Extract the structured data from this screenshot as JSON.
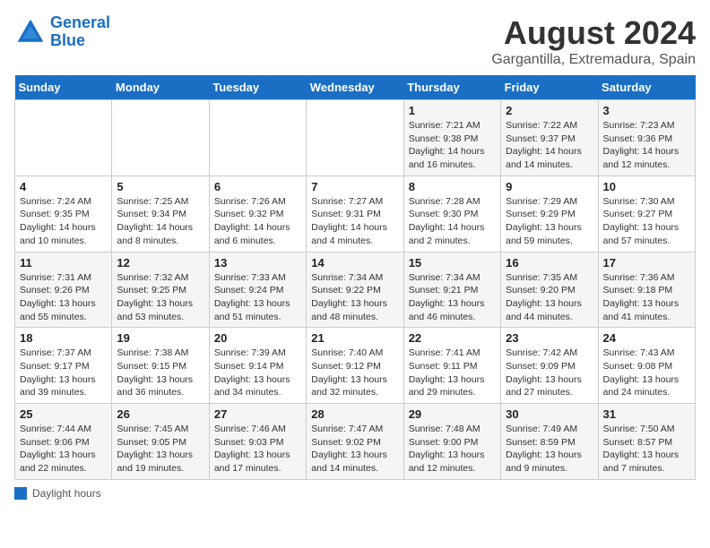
{
  "header": {
    "logo_line1": "General",
    "logo_line2": "Blue",
    "main_title": "August 2024",
    "subtitle": "Gargantilla, Extremadura, Spain"
  },
  "weekdays": [
    "Sunday",
    "Monday",
    "Tuesday",
    "Wednesday",
    "Thursday",
    "Friday",
    "Saturday"
  ],
  "weeks": [
    [
      {
        "day": "",
        "info": ""
      },
      {
        "day": "",
        "info": ""
      },
      {
        "day": "",
        "info": ""
      },
      {
        "day": "",
        "info": ""
      },
      {
        "day": "1",
        "info": "Sunrise: 7:21 AM\nSunset: 9:38 PM\nDaylight: 14 hours and 16 minutes."
      },
      {
        "day": "2",
        "info": "Sunrise: 7:22 AM\nSunset: 9:37 PM\nDaylight: 14 hours and 14 minutes."
      },
      {
        "day": "3",
        "info": "Sunrise: 7:23 AM\nSunset: 9:36 PM\nDaylight: 14 hours and 12 minutes."
      }
    ],
    [
      {
        "day": "4",
        "info": "Sunrise: 7:24 AM\nSunset: 9:35 PM\nDaylight: 14 hours and 10 minutes."
      },
      {
        "day": "5",
        "info": "Sunrise: 7:25 AM\nSunset: 9:34 PM\nDaylight: 14 hours and 8 minutes."
      },
      {
        "day": "6",
        "info": "Sunrise: 7:26 AM\nSunset: 9:32 PM\nDaylight: 14 hours and 6 minutes."
      },
      {
        "day": "7",
        "info": "Sunrise: 7:27 AM\nSunset: 9:31 PM\nDaylight: 14 hours and 4 minutes."
      },
      {
        "day": "8",
        "info": "Sunrise: 7:28 AM\nSunset: 9:30 PM\nDaylight: 14 hours and 2 minutes."
      },
      {
        "day": "9",
        "info": "Sunrise: 7:29 AM\nSunset: 9:29 PM\nDaylight: 13 hours and 59 minutes."
      },
      {
        "day": "10",
        "info": "Sunrise: 7:30 AM\nSunset: 9:27 PM\nDaylight: 13 hours and 57 minutes."
      }
    ],
    [
      {
        "day": "11",
        "info": "Sunrise: 7:31 AM\nSunset: 9:26 PM\nDaylight: 13 hours and 55 minutes."
      },
      {
        "day": "12",
        "info": "Sunrise: 7:32 AM\nSunset: 9:25 PM\nDaylight: 13 hours and 53 minutes."
      },
      {
        "day": "13",
        "info": "Sunrise: 7:33 AM\nSunset: 9:24 PM\nDaylight: 13 hours and 51 minutes."
      },
      {
        "day": "14",
        "info": "Sunrise: 7:34 AM\nSunset: 9:22 PM\nDaylight: 13 hours and 48 minutes."
      },
      {
        "day": "15",
        "info": "Sunrise: 7:34 AM\nSunset: 9:21 PM\nDaylight: 13 hours and 46 minutes."
      },
      {
        "day": "16",
        "info": "Sunrise: 7:35 AM\nSunset: 9:20 PM\nDaylight: 13 hours and 44 minutes."
      },
      {
        "day": "17",
        "info": "Sunrise: 7:36 AM\nSunset: 9:18 PM\nDaylight: 13 hours and 41 minutes."
      }
    ],
    [
      {
        "day": "18",
        "info": "Sunrise: 7:37 AM\nSunset: 9:17 PM\nDaylight: 13 hours and 39 minutes."
      },
      {
        "day": "19",
        "info": "Sunrise: 7:38 AM\nSunset: 9:15 PM\nDaylight: 13 hours and 36 minutes."
      },
      {
        "day": "20",
        "info": "Sunrise: 7:39 AM\nSunset: 9:14 PM\nDaylight: 13 hours and 34 minutes."
      },
      {
        "day": "21",
        "info": "Sunrise: 7:40 AM\nSunset: 9:12 PM\nDaylight: 13 hours and 32 minutes."
      },
      {
        "day": "22",
        "info": "Sunrise: 7:41 AM\nSunset: 9:11 PM\nDaylight: 13 hours and 29 minutes."
      },
      {
        "day": "23",
        "info": "Sunrise: 7:42 AM\nSunset: 9:09 PM\nDaylight: 13 hours and 27 minutes."
      },
      {
        "day": "24",
        "info": "Sunrise: 7:43 AM\nSunset: 9:08 PM\nDaylight: 13 hours and 24 minutes."
      }
    ],
    [
      {
        "day": "25",
        "info": "Sunrise: 7:44 AM\nSunset: 9:06 PM\nDaylight: 13 hours and 22 minutes."
      },
      {
        "day": "26",
        "info": "Sunrise: 7:45 AM\nSunset: 9:05 PM\nDaylight: 13 hours and 19 minutes."
      },
      {
        "day": "27",
        "info": "Sunrise: 7:46 AM\nSunset: 9:03 PM\nDaylight: 13 hours and 17 minutes."
      },
      {
        "day": "28",
        "info": "Sunrise: 7:47 AM\nSunset: 9:02 PM\nDaylight: 13 hours and 14 minutes."
      },
      {
        "day": "29",
        "info": "Sunrise: 7:48 AM\nSunset: 9:00 PM\nDaylight: 13 hours and 12 minutes."
      },
      {
        "day": "30",
        "info": "Sunrise: 7:49 AM\nSunset: 8:59 PM\nDaylight: 13 hours and 9 minutes."
      },
      {
        "day": "31",
        "info": "Sunrise: 7:50 AM\nSunset: 8:57 PM\nDaylight: 13 hours and 7 minutes."
      }
    ]
  ],
  "footer": {
    "label": "Daylight hours"
  }
}
